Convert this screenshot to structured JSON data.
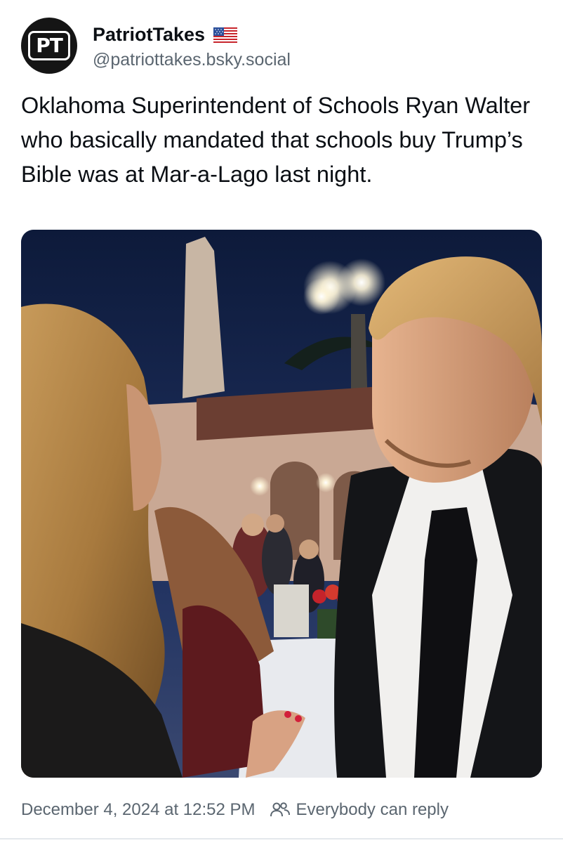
{
  "author": {
    "display_name": "PatriotTakes",
    "handle": "@patriottakes.bsky.social",
    "avatar_initials": "PT",
    "flag_icon": "us-flag-icon"
  },
  "post": {
    "text": "Oklahoma Superintendent of Schools Ryan Walter who basically mandated that schools buy Trump’s Bible was at Mar-a-Lago last night.",
    "image_icon": "photo-image"
  },
  "footer": {
    "timestamp": "December 4, 2024 at 12:52 PM",
    "reply_setting": "Everybody can reply",
    "reply_icon": "people-icon"
  },
  "colors": {
    "text": "#0b0f14",
    "muted": "#5b6670",
    "avatar_bg": "#151515"
  }
}
